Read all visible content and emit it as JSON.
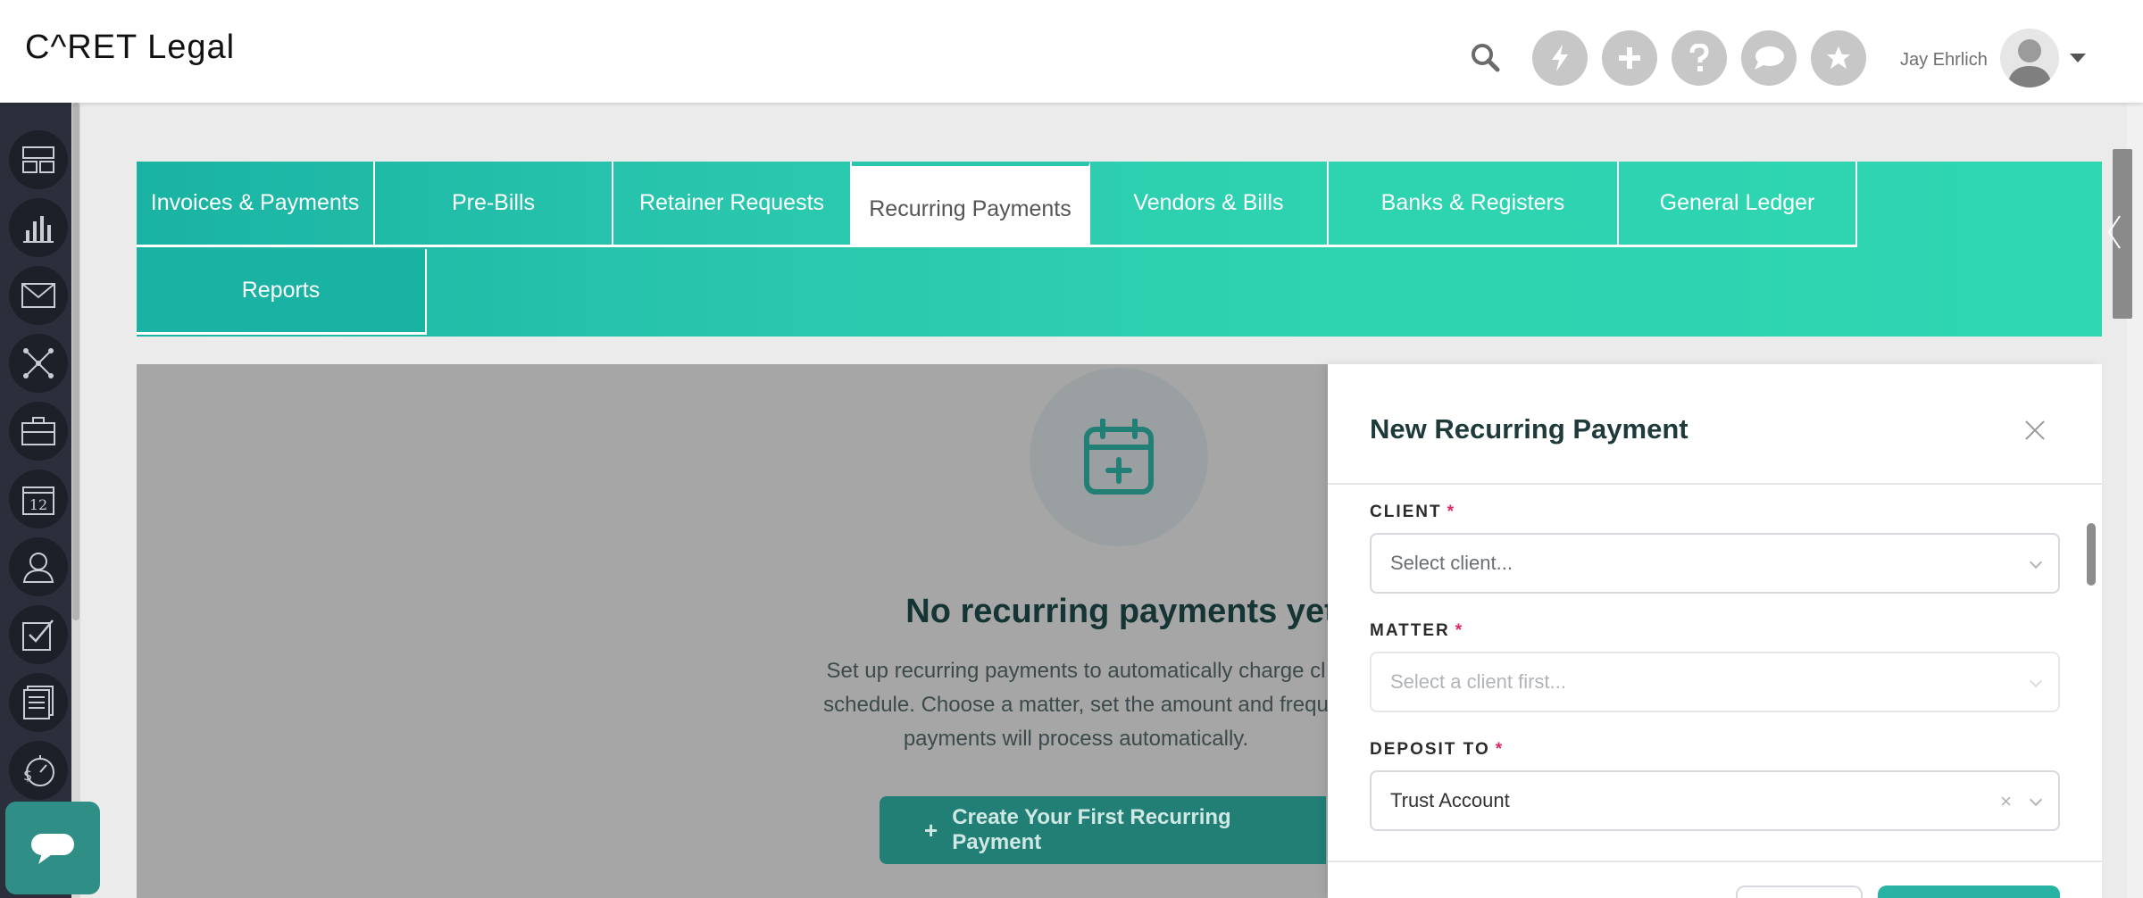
{
  "header": {
    "logo_text": "C^RET Legal",
    "user_name": "Jay Ehrlich",
    "icons": [
      "search-icon",
      "lightning-icon",
      "plus-icon",
      "help-icon",
      "chat-icon",
      "star-icon"
    ]
  },
  "sidebar": {
    "items": [
      "dashboard-icon",
      "chart-icon",
      "mail-icon",
      "network-icon",
      "briefcase-icon",
      "calendar-icon",
      "contacts-icon",
      "tasks-icon",
      "documents-icon",
      "billing-icon"
    ],
    "calendar_day": "12"
  },
  "tabs": {
    "invoices": "Invoices & Payments",
    "prebills": "Pre-Bills",
    "retainer": "Retainer Requests",
    "recurring": "Recurring Payments",
    "vendors": "Vendors & Bills",
    "banks": "Banks & Registers",
    "ledger": "General Ledger",
    "reports": "Reports"
  },
  "empty_state": {
    "title": "No recurring payments yet",
    "description": "Set up recurring payments to automatically charge cl schedule. Choose a matter, set the amount and frequ payments will process automatically.",
    "cta": "Create Your First Recurring Payment",
    "cta_icon": "+"
  },
  "panel": {
    "title": "New Recurring Payment",
    "client_label": "CLIENT",
    "client_placeholder": "Select client...",
    "matter_label": "MATTER",
    "matter_placeholder": "Select a client first...",
    "deposit_label": "DEPOSIT TO",
    "deposit_value": "Trust Account",
    "required_mark": "*"
  },
  "colors": {
    "accent": "#29c6ad",
    "cta": "#217f76",
    "sidebar": "#2a2f3b",
    "required": "#e0245e"
  }
}
